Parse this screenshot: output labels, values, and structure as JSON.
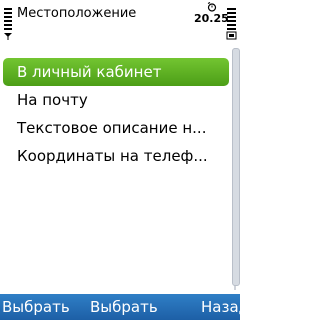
{
  "statusbar": {
    "title": "Местоположение",
    "clock": "20.25",
    "icons": [
      "signal-strength-icon",
      "alarm-icon",
      "battery-icon"
    ]
  },
  "list": {
    "items": [
      {
        "label": "В личный кабинет",
        "selected": true
      },
      {
        "label": "На почту",
        "selected": false
      },
      {
        "label": "Текстовое описание н...",
        "selected": false
      },
      {
        "label": "Координаты на телеф...",
        "selected": false
      }
    ]
  },
  "softkeys": {
    "left": "Выбрать",
    "middle": "Выбрать",
    "right": "Назад"
  },
  "colors": {
    "selection": "#5fb224",
    "softkey_bar": "#2670b8",
    "text": "#000000"
  }
}
